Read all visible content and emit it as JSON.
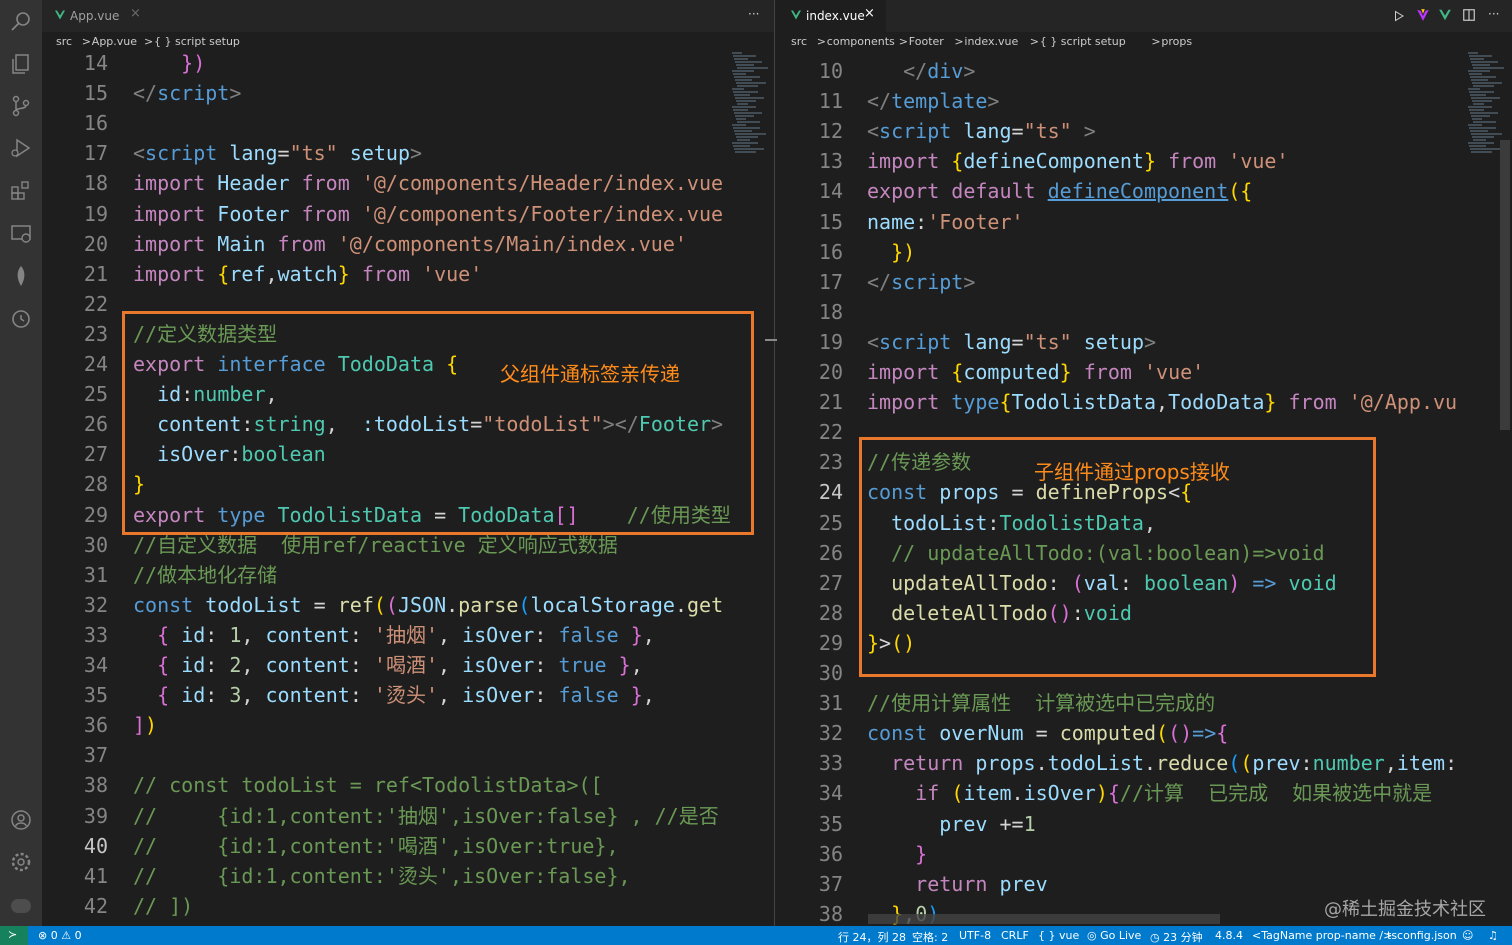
{
  "left": {
    "tab": "App.vue",
    "more": "···",
    "breadcrumb": [
      "src",
      ">",
      "App.vue",
      ">",
      "{ } script setup"
    ],
    "lines": [
      {
        "n": "14",
        "html": "    <span class=\"pk\">})</span>"
      },
      {
        "n": "15",
        "html": "<span class=\"g\">&lt;/</span><span class=\"tg\">script</span><span class=\"g\">&gt;</span>"
      },
      {
        "n": "16",
        "html": ""
      },
      {
        "n": "17",
        "html": "<span class=\"g\">&lt;</span><span class=\"tg\">script</span> <span class=\"v\">lang</span><span class=\"p\">=</span><span class=\"s\">\"ts\"</span> <span class=\"v\">setup</span><span class=\"g\">&gt;</span>"
      },
      {
        "n": "18",
        "html": "<span class=\"c\">import</span> <span class=\"v\">Header</span> <span class=\"c\">from</span> <span class=\"s\">'@/components/Header/index.vue</span>"
      },
      {
        "n": "19",
        "html": "<span class=\"c\">import</span> <span class=\"v\">Footer</span> <span class=\"c\">from</span> <span class=\"s\">'@/components/Footer/index.vue</span>"
      },
      {
        "n": "20",
        "html": "<span class=\"c\">import</span> <span class=\"v\">Main</span> <span class=\"c\">from</span> <span class=\"s\">'@/components/Main/index.vue'</span>"
      },
      {
        "n": "21",
        "html": "<span class=\"c\">import</span> <span class=\"y\">{</span><span class=\"v\">ref</span><span class=\"p\">,</span><span class=\"v\">watch</span><span class=\"y\">}</span> <span class=\"c\">from</span> <span class=\"s\">'vue'</span>"
      },
      {
        "n": "22",
        "html": ""
      },
      {
        "n": "23",
        "html": "<span class=\"cm\">//定义数据类型</span>"
      },
      {
        "n": "24",
        "html": "<span class=\"c\">export</span> <span class=\"k\">interface</span> <span class=\"t\">TodoData</span> <span class=\"y\">{</span>"
      },
      {
        "n": "25",
        "html": "  <span class=\"v\">id</span><span class=\"p\">:</span><span class=\"t\">number</span><span class=\"p\">,</span>"
      },
      {
        "n": "26",
        "html": "  <span class=\"v\">content</span><span class=\"p\">:</span><span class=\"t\">string</span><span class=\"p\">,</span>  <span class=\"v\">:todoList</span><span class=\"p\">=</span><span class=\"s\">\"todoList\"</span><span class=\"g\">&gt;&lt;/</span><span class=\"t\">Footer</span><span class=\"g\">&gt;</span>"
      },
      {
        "n": "27",
        "html": "  <span class=\"v\">isOver</span><span class=\"p\">:</span><span class=\"t\">boolean</span>"
      },
      {
        "n": "28",
        "html": "<span class=\"y\">}</span>"
      },
      {
        "n": "29",
        "html": "<span class=\"c\">export</span> <span class=\"k\">type</span> <span class=\"t\">TodolistData</span> <span class=\"p\">=</span> <span class=\"t\">TodoData</span><span class=\"pk\">[]</span>    <span class=\"cm\">//使用类型</span>"
      },
      {
        "n": "30",
        "html": "<span class=\"cm\">//自定义数据  使用ref/reactive 定义响应式数据</span>"
      },
      {
        "n": "31",
        "html": "<span class=\"cm\">//做本地化存储</span>"
      },
      {
        "n": "32",
        "html": "<span class=\"k\">const</span> <span class=\"v\">todoList</span> <span class=\"p\">=</span> <span class=\"f\">ref</span><span class=\"y\">(</span><span class=\"pk\">(</span><span class=\"v\">JSON</span><span class=\"p\">.</span><span class=\"f\">parse</span><span class=\"bl\">(</span><span class=\"v\">localStorage</span><span class=\"p\">.</span><span class=\"f\">get</span>"
      },
      {
        "n": "33",
        "html": "  <span class=\"pk\">{</span> <span class=\"v\">id</span><span class=\"p\">:</span> <span class=\"n\">1</span><span class=\"p\">,</span> <span class=\"v\">content</span><span class=\"p\">:</span> <span class=\"s\">'抽烟'</span><span class=\"p\">,</span> <span class=\"v\">isOver</span><span class=\"p\">:</span> <span class=\"k\">false</span> <span class=\"pk\">}</span><span class=\"p\">,</span>"
      },
      {
        "n": "34",
        "html": "  <span class=\"pk\">{</span> <span class=\"v\">id</span><span class=\"p\">:</span> <span class=\"n\">2</span><span class=\"p\">,</span> <span class=\"v\">content</span><span class=\"p\">:</span> <span class=\"s\">'喝酒'</span><span class=\"p\">,</span> <span class=\"v\">isOver</span><span class=\"p\">:</span> <span class=\"k\">true</span> <span class=\"pk\">}</span><span class=\"p\">,</span>"
      },
      {
        "n": "35",
        "html": "  <span class=\"pk\">{</span> <span class=\"v\">id</span><span class=\"p\">:</span> <span class=\"n\">3</span><span class=\"p\">,</span> <span class=\"v\">content</span><span class=\"p\">:</span> <span class=\"s\">'烫头'</span><span class=\"p\">,</span> <span class=\"v\">isOver</span><span class=\"p\">:</span> <span class=\"k\">false</span> <span class=\"pk\">}</span><span class=\"p\">,</span>"
      },
      {
        "n": "36",
        "html": "<span class=\"pk\">]</span><span class=\"y\">)</span>"
      },
      {
        "n": "37",
        "html": ""
      },
      {
        "n": "38",
        "html": "<span class=\"cm\">// const todoList = ref&lt;TodolistData&gt;([</span>"
      },
      {
        "n": "39",
        "html": "<span class=\"cm\">//     {id:1,content:'抽烟',isOver:false} , //是否</span>"
      },
      {
        "n": "40",
        "html": "<span class=\"cm\">//     {id:1,content:'喝酒',isOver:true},</span>"
      },
      {
        "n": "41",
        "html": "<span class=\"cm\">//     {id:1,content:'烫头',isOver:false},</span>"
      },
      {
        "n": "42",
        "html": "<span class=\"cm\">// ])</span>"
      }
    ],
    "annotation": "父组件通标签亲传递"
  },
  "right": {
    "tab": "index.vue",
    "close": "×",
    "breadcrumb": [
      "src",
      ">",
      "components",
      ">",
      "Footer",
      ">",
      "index.vue",
      ">",
      "{ } script setup",
      ">",
      "props"
    ],
    "lines": [
      {
        "n": "10",
        "html": "   <span class=\"g\">&lt;/</span><span class=\"tg\">div</span><span class=\"g\">&gt;</span>"
      },
      {
        "n": "11",
        "html": "<span class=\"g\">&lt;/</span><span class=\"tg\">template</span><span class=\"g\">&gt;</span>"
      },
      {
        "n": "12",
        "html": "<span class=\"g\">&lt;</span><span class=\"tg\">script</span> <span class=\"v\">lang</span><span class=\"p\">=</span><span class=\"s\">\"ts\"</span> <span class=\"g\">&gt;</span>"
      },
      {
        "n": "13",
        "html": "<span class=\"c\">import</span> <span class=\"y\">{</span><span class=\"v\">defineComponent</span><span class=\"y\">}</span> <span class=\"c\">from</span> <span class=\"s\">'vue'</span>"
      },
      {
        "n": "14",
        "html": "<span class=\"c\">export</span> <span class=\"c\">default</span> <span class=\"u\">defineComponent</span><span class=\"y\">({</span>"
      },
      {
        "n": "15",
        "html": "<span class=\"v\">name</span><span class=\"p\">:</span><span class=\"s\">'Footer'</span>"
      },
      {
        "n": "16",
        "html": "  <span class=\"y\">})</span>"
      },
      {
        "n": "17",
        "html": "<span class=\"g\">&lt;/</span><span class=\"tg\">script</span><span class=\"g\">&gt;</span>"
      },
      {
        "n": "18",
        "html": ""
      },
      {
        "n": "19",
        "html": "<span class=\"g\">&lt;</span><span class=\"tg\">script</span> <span class=\"v\">lang</span><span class=\"p\">=</span><span class=\"s\">\"ts\"</span> <span class=\"v\">setup</span><span class=\"g\">&gt;</span>"
      },
      {
        "n": "20",
        "html": "<span class=\"c\">import</span> <span class=\"y\">{</span><span class=\"v\">computed</span><span class=\"y\">}</span> <span class=\"c\">from</span> <span class=\"s\">'vue'</span>"
      },
      {
        "n": "21",
        "html": "<span class=\"c\">import</span> <span class=\"k\">type</span><span class=\"y\">{</span><span class=\"v\">TodolistData</span><span class=\"p\">,</span><span class=\"v\">TodoData</span><span class=\"y\">}</span> <span class=\"c\">from</span> <span class=\"s\">'@/App.vu</span>"
      },
      {
        "n": "22",
        "html": ""
      },
      {
        "n": "23",
        "html": "<span class=\"cm\">//传递参数</span>"
      },
      {
        "n": "24",
        "html": "<span class=\"k\">const</span> <span class=\"v\">props</span> <span class=\"p\">=</span> <span class=\"f\">defineProps</span><span class=\"p\">&lt;</span><span class=\"y\">{</span>"
      },
      {
        "n": "25",
        "html": "  <span class=\"v\">todoList</span><span class=\"p\">:</span><span class=\"t\">TodolistData</span><span class=\"p\">,</span>"
      },
      {
        "n": "26",
        "html": "  <span class=\"cm\">// updateAllTodo:(val:boolean)=&gt;void</span>"
      },
      {
        "n": "27",
        "html": "  <span class=\"f\">updateAllTodo</span><span class=\"p\">:</span> <span class=\"pk\">(</span><span class=\"v\">val</span><span class=\"p\">:</span> <span class=\"t\">boolean</span><span class=\"pk\">)</span> <span class=\"k\">=&gt;</span> <span class=\"t\">void</span>"
      },
      {
        "n": "28",
        "html": "  <span class=\"f\">deleteAllTodo</span><span class=\"pk\">()</span><span class=\"p\">:</span><span class=\"t\">void</span>"
      },
      {
        "n": "29",
        "html": "<span class=\"y\">}</span><span class=\"p\">&gt;</span><span class=\"y\">()</span>"
      },
      {
        "n": "30",
        "html": ""
      },
      {
        "n": "31",
        "html": "<span class=\"cm\">//使用计算属性  计算被选中已完成的</span>"
      },
      {
        "n": "32",
        "html": "<span class=\"k\">const</span> <span class=\"v\">overNum</span> <span class=\"p\">=</span> <span class=\"f\">computed</span><span class=\"y\">(</span><span class=\"pk\">()</span><span class=\"k\">=&gt;</span><span class=\"pk\">{</span>"
      },
      {
        "n": "33",
        "html": "  <span class=\"c\">return</span> <span class=\"v\">props</span><span class=\"p\">.</span><span class=\"v\">todoList</span><span class=\"p\">.</span><span class=\"f\">reduce</span><span class=\"bl\">(</span><span class=\"y\">(</span><span class=\"v\">prev</span><span class=\"p\">:</span><span class=\"t\">number</span><span class=\"p\">,</span><span class=\"v\">item</span><span class=\"p\">:</span>"
      },
      {
        "n": "34",
        "html": "    <span class=\"c\">if</span> <span class=\"y\">(</span><span class=\"v\">item</span><span class=\"p\">.</span><span class=\"v\">isOver</span><span class=\"y\">)</span><span class=\"pk\">{</span><span class=\"cm\">//计算  已完成  如果被选中就是</span>"
      },
      {
        "n": "35",
        "html": "      <span class=\"v\">prev</span> <span class=\"p\">+=</span><span class=\"n\">1</span>"
      },
      {
        "n": "36",
        "html": "    <span class=\"pk\">}</span>"
      },
      {
        "n": "37",
        "html": "    <span class=\"c\">return</span> <span class=\"v\">prev</span>"
      },
      {
        "n": "38",
        "html": "  <span class=\"y\">}</span><span class=\"p\">,</span><span class=\"n\">0</span><span class=\"bl\">)</span>"
      }
    ],
    "annotation": "子组件通过props接收"
  },
  "watermark": "@稀土掘金技术社区",
  "status": {
    "errors": "⊗ 0 ⚠ 0",
    "position": "行 24，列 28",
    "spaces": "空格: 2",
    "encoding": "UTF-8",
    "eol": "CRLF",
    "language": "{ } vue",
    "golive": "◎ Go Live",
    "time": "◷ 23 分钟",
    "version": "4.8.4",
    "tag": "<TagName prop-name />",
    "tsconfig": "tsconfig.json"
  },
  "colors": {
    "annotation_box": "#e9782c",
    "status_bar": "#007acc",
    "vue_green": "#41b883"
  },
  "icons": [
    "search-icon",
    "explorer-icon",
    "source-control-icon",
    "run-debug-icon",
    "extensions-icon",
    "remote-explorer-icon",
    "mongodb-icon",
    "timeline-icon",
    "account-icon",
    "settings-icon",
    "run-icon",
    "split-editor-icon"
  ]
}
